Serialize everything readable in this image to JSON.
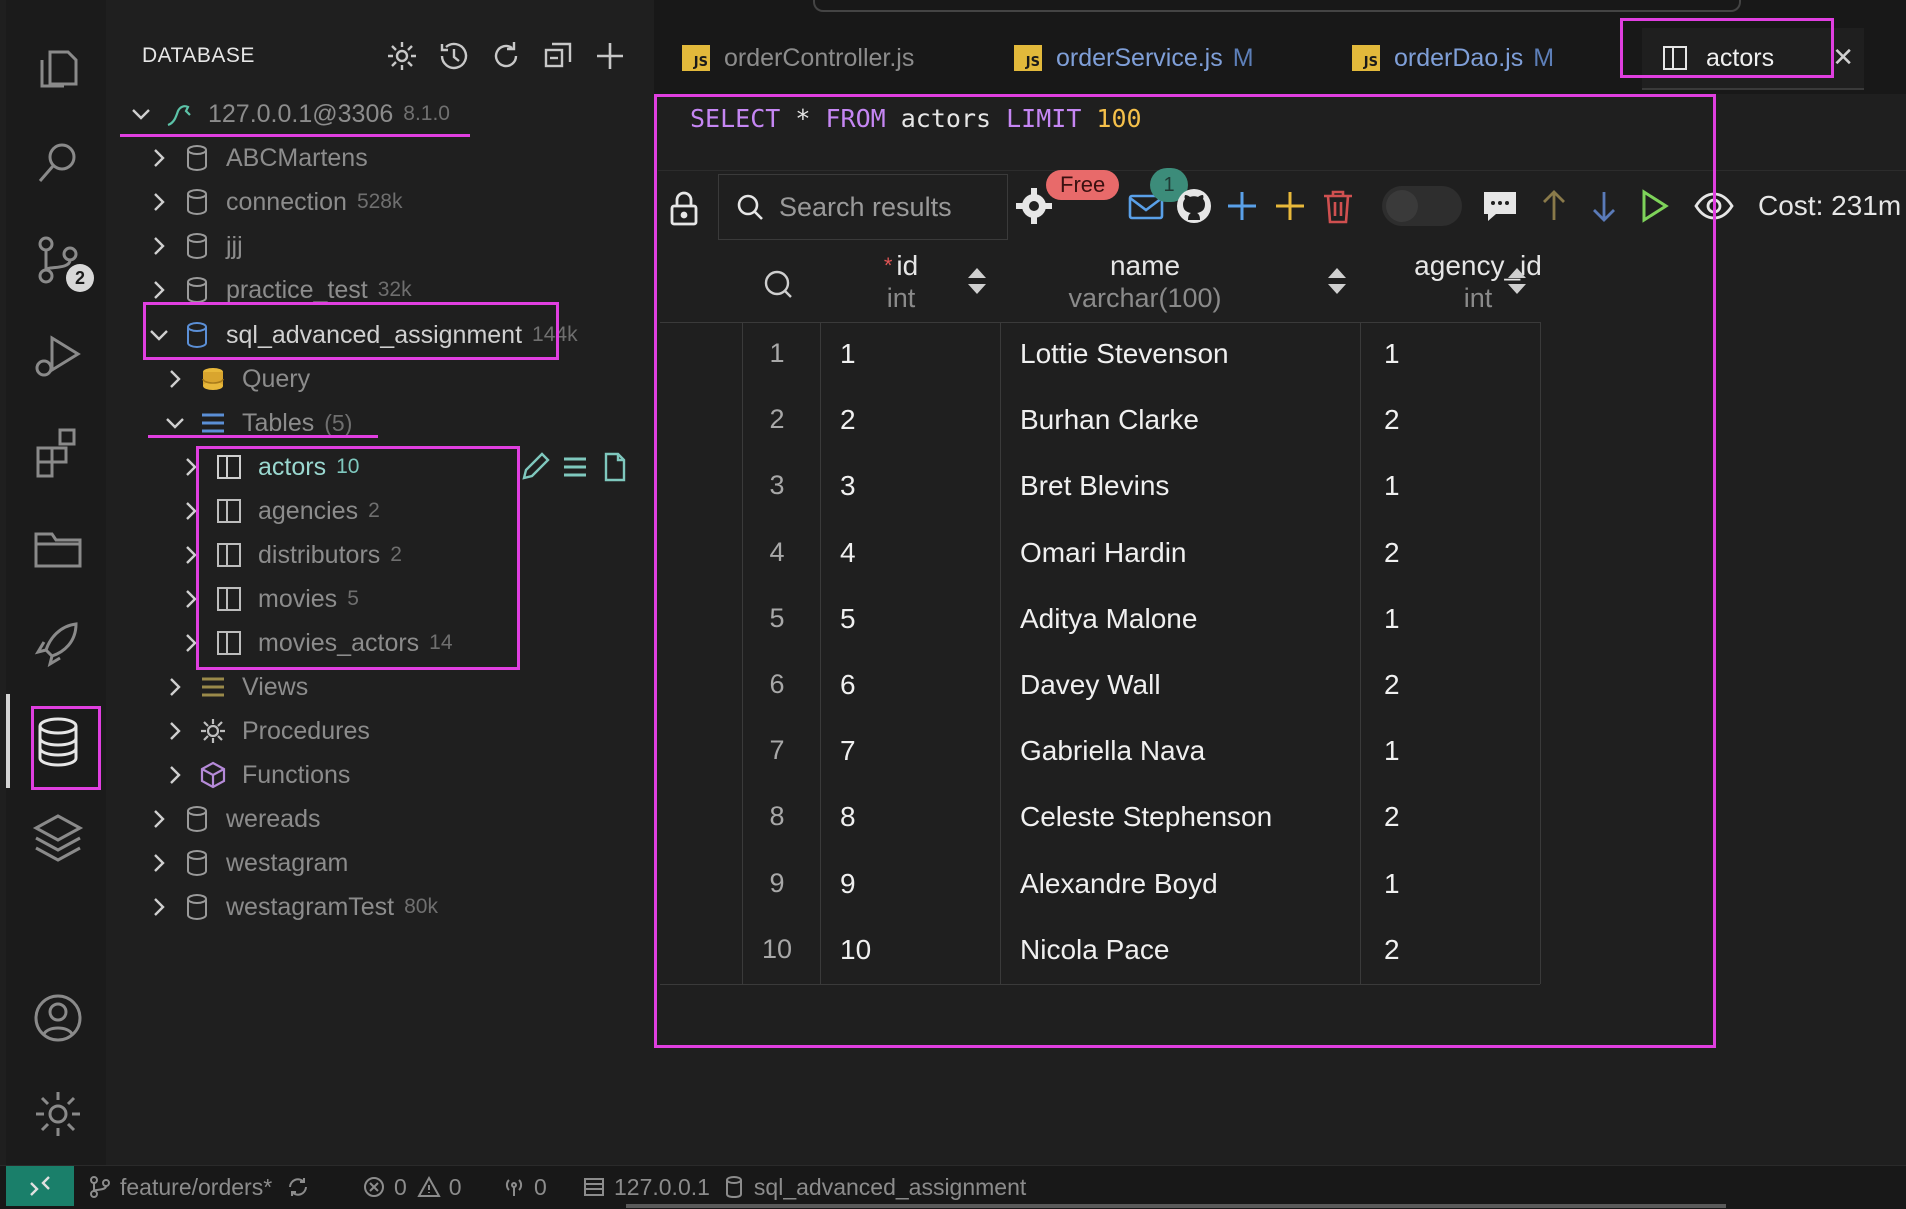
{
  "sidebar": {
    "title": "DATABASE",
    "connection": {
      "label": "127.0.0.1@3306",
      "version": "8.1.0"
    },
    "databases_top": [
      {
        "name": "ABCMartens",
        "size": ""
      },
      {
        "name": "connection",
        "size": "528k"
      },
      {
        "name": "jjj",
        "size": ""
      },
      {
        "name": "practice_test",
        "size": "32k"
      }
    ],
    "active_db": {
      "name": "sql_advanced_assignment",
      "size": "144k"
    },
    "query": "Query",
    "tables": {
      "label": "Tables",
      "count": "(5)"
    },
    "table_items": [
      {
        "name": "actors",
        "count": "10"
      },
      {
        "name": "agencies",
        "count": "2"
      },
      {
        "name": "distributors",
        "count": "2"
      },
      {
        "name": "movies",
        "count": "5"
      },
      {
        "name": "movies_actors",
        "count": "14"
      }
    ],
    "views": "Views",
    "procedures": "Procedures",
    "functions": "Functions",
    "databases_bottom": [
      {
        "name": "wereads",
        "size": ""
      },
      {
        "name": "westagram",
        "size": ""
      },
      {
        "name": "westagramTest",
        "size": "80k"
      }
    ]
  },
  "tabs": [
    {
      "label": "orderController.js",
      "modified": ""
    },
    {
      "label": "orderService.js",
      "modified": "M"
    },
    {
      "label": "orderDao.js",
      "modified": "M"
    },
    {
      "label": "actors",
      "modified": ""
    }
  ],
  "editor": {
    "sql": {
      "select": "SELECT",
      "star": " * ",
      "from": "FROM",
      "table": " actors ",
      "limit": "LIMIT",
      "limit_value": " 100"
    }
  },
  "toolbar": {
    "search_placeholder": "Search results",
    "free_badge": "Free",
    "notification_count": "1",
    "cost": "Cost: 231m"
  },
  "table": {
    "columns": [
      {
        "name": "id",
        "type": "int",
        "required": "*"
      },
      {
        "name": "name",
        "type": "varchar(100)"
      },
      {
        "name": "agency_id",
        "type": "int"
      }
    ],
    "rows": [
      {
        "n": "1",
        "id": "1",
        "name": "Lottie Stevenson",
        "agency_id": "1"
      },
      {
        "n": "2",
        "id": "2",
        "name": "Burhan Clarke",
        "agency_id": "2"
      },
      {
        "n": "3",
        "id": "3",
        "name": "Bret Blevins",
        "agency_id": "1"
      },
      {
        "n": "4",
        "id": "4",
        "name": "Omari Hardin",
        "agency_id": "2"
      },
      {
        "n": "5",
        "id": "5",
        "name": "Aditya Malone",
        "agency_id": "1"
      },
      {
        "n": "6",
        "id": "6",
        "name": "Davey Wall",
        "agency_id": "2"
      },
      {
        "n": "7",
        "id": "7",
        "name": "Gabriella Nava",
        "agency_id": "1"
      },
      {
        "n": "8",
        "id": "8",
        "name": "Celeste Stephenson",
        "agency_id": "2"
      },
      {
        "n": "9",
        "id": "9",
        "name": "Alexandre Boyd",
        "agency_id": "1"
      },
      {
        "n": "10",
        "id": "10",
        "name": "Nicola Pace",
        "agency_id": "2"
      }
    ]
  },
  "statusbar": {
    "remote_icon": "remote-icon",
    "branch": "feature/orders*",
    "errors": "0",
    "warnings": "0",
    "ports": "0",
    "host": "127.0.0.1",
    "database": "sql_advanced_assignment"
  },
  "colors": {
    "highlight": "#e03fe0",
    "keyword": "#c586f3",
    "number": "#f5c04a",
    "js_icon": "#e2b93b",
    "free_badge": "#e86a6a"
  }
}
